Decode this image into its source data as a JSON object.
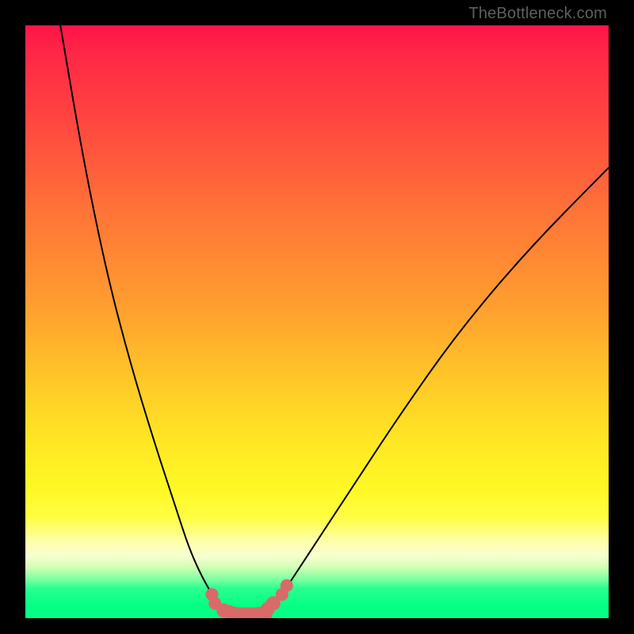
{
  "watermark": "TheBottleneck.com",
  "colors": {
    "frame": "#000000",
    "gradient_top": "#ff1448",
    "gradient_mid": "#ffe624",
    "gradient_bottom": "#04ff84",
    "curve": "#000000",
    "marker": "#d86a6a"
  },
  "chart_data": {
    "type": "line",
    "title": "",
    "xlabel": "",
    "ylabel": "",
    "xlim": [
      0,
      100
    ],
    "ylim": [
      0,
      100
    ],
    "series": [
      {
        "name": "left-branch",
        "x": [
          6,
          10,
          14,
          18,
          22,
          26,
          28,
          30,
          32,
          33,
          34,
          35,
          36
        ],
        "y": [
          100,
          77,
          58,
          43,
          30,
          18,
          12,
          7.5,
          4,
          2.5,
          1.5,
          1,
          0.7
        ]
      },
      {
        "name": "right-branch",
        "x": [
          40,
          41,
          42,
          44,
          46,
          50,
          56,
          64,
          74,
          86,
          100
        ],
        "y": [
          0.7,
          1.2,
          2,
          4,
          7,
          13,
          22,
          34,
          48,
          62,
          76
        ]
      },
      {
        "name": "markers",
        "x": [
          32,
          32.5,
          34,
          35,
          36,
          37,
          38,
          39,
          40,
          41.5,
          42.5,
          44,
          44.8
        ],
        "y": [
          4,
          2.5,
          1.3,
          1,
          0.7,
          0.6,
          0.6,
          0.6,
          0.7,
          1.5,
          2.5,
          4,
          5.5
        ]
      }
    ]
  }
}
